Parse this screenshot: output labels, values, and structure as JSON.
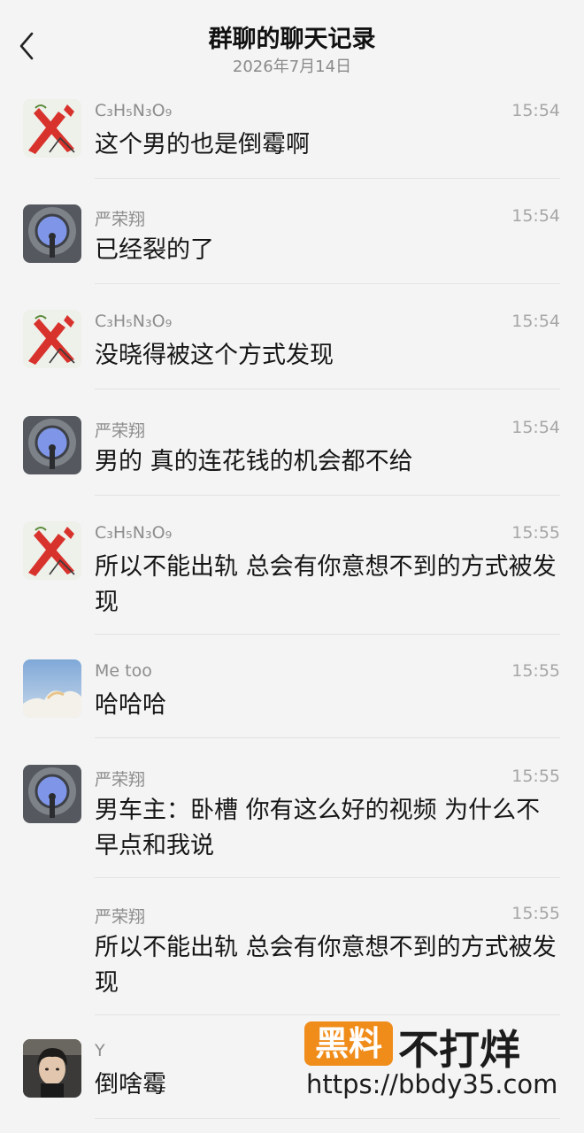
{
  "header": {
    "title": "群聊的聊天记录",
    "date": "2026年7月14日"
  },
  "messages": [
    {
      "sender": "C₃H₅N₃O₉",
      "time": "15:54",
      "text": "这个男的也是倒霉啊",
      "avatar": "red-x-icon"
    },
    {
      "sender": "严荣翔",
      "time": "15:54",
      "text": "已经裂的了",
      "avatar": "tunnel-photo"
    },
    {
      "sender": "C₃H₅N₃O₉",
      "time": "15:54",
      "text": "没晓得被这个方式发现",
      "avatar": "red-x-icon"
    },
    {
      "sender": "严荣翔",
      "time": "15:54",
      "text": "男的 真的连花钱的机会都不给",
      "avatar": "tunnel-photo"
    },
    {
      "sender": "C₃H₅N₃O₉",
      "time": "15:55",
      "text": "所以不能出轨 总会有你意想不到的方式被发现",
      "avatar": "red-x-icon"
    },
    {
      "sender": "Me too",
      "time": "15:55",
      "text": "哈哈哈",
      "avatar": "sky-photo"
    },
    {
      "sender": "严荣翔",
      "time": "15:55",
      "text": "男车主：卧槽 你有这么好的视频 为什么不早点和我说",
      "avatar": "tunnel-photo"
    },
    {
      "sender": "严荣翔",
      "time": "15:55",
      "text": "所以不能出轨 总会有你意想不到的方式被发现",
      "avatar": "none"
    },
    {
      "sender": "Y",
      "time": "",
      "text": "倒啥霉",
      "avatar": "person-photo"
    }
  ],
  "watermark": {
    "box_text": "黑料",
    "brand_text": "不打烊",
    "url": "https://bbdy35.com",
    "accent_color": "#f08c1a"
  }
}
